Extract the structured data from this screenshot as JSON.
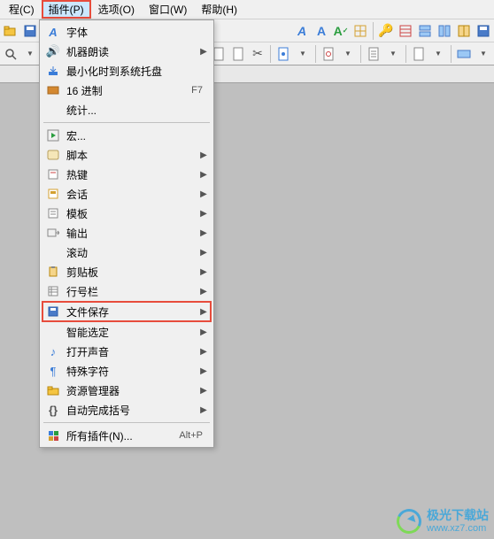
{
  "menubar": {
    "items": [
      {
        "label": "程(C)"
      },
      {
        "label": "插件(P)"
      },
      {
        "label": "选项(O)"
      },
      {
        "label": "窗口(W)"
      },
      {
        "label": "帮助(H)"
      }
    ],
    "highlighted_index": 1
  },
  "toolbar1": {
    "icons": [
      "folder-open",
      "save",
      "save-all",
      "sep",
      "font-a",
      "font-a2",
      "check-a",
      "table",
      "sep",
      "key",
      "table-red",
      "split-h",
      "split-v",
      "layout",
      "save-blue"
    ]
  },
  "toolbar2": {
    "icons": [
      "search",
      "dropdown",
      "sep",
      "page",
      "page",
      "page",
      "cut",
      "sep",
      "doc-left",
      "dropdown",
      "sep",
      "gear",
      "dropdown",
      "sep",
      "list",
      "dropdown",
      "sep",
      "doc",
      "dropdown",
      "sep",
      "filter",
      "dropdown"
    ]
  },
  "dropdown": {
    "highlighted_index": 15,
    "items": [
      {
        "icon": "font",
        "label": "字体",
        "arrow": false
      },
      {
        "icon": "speaker",
        "label": "机器朗读",
        "arrow": true
      },
      {
        "icon": "tray",
        "label": "最小化时到系统托盘",
        "arrow": false
      },
      {
        "icon": "hex",
        "label": "16 进制",
        "shortcut": "F7",
        "arrow": false
      },
      {
        "icon": "",
        "label": "统计...",
        "arrow": false
      },
      {
        "sep": true
      },
      {
        "icon": "play",
        "label": "宏...",
        "arrow": false
      },
      {
        "icon": "script",
        "label": "脚本",
        "arrow": true
      },
      {
        "icon": "hotkey",
        "label": "热键",
        "arrow": true
      },
      {
        "icon": "session",
        "label": "会话",
        "arrow": true
      },
      {
        "icon": "template",
        "label": "模板",
        "arrow": true
      },
      {
        "icon": "output",
        "label": "输出",
        "arrow": true
      },
      {
        "icon": "",
        "label": "滚动",
        "arrow": true
      },
      {
        "icon": "clipboard",
        "label": "剪贴板",
        "arrow": true
      },
      {
        "icon": "linenum",
        "label": "行号栏",
        "arrow": true
      },
      {
        "icon": "save",
        "label": "文件保存",
        "arrow": true
      },
      {
        "icon": "",
        "label": "智能选定",
        "arrow": true
      },
      {
        "icon": "sound",
        "label": "打开声音",
        "arrow": true
      },
      {
        "icon": "pilcrow",
        "label": "特殊字符",
        "arrow": true
      },
      {
        "icon": "folder",
        "label": "资源管理器",
        "arrow": true
      },
      {
        "icon": "bracket",
        "label": "自动完成括号",
        "arrow": true
      },
      {
        "sep": true
      },
      {
        "icon": "plugins",
        "label": "所有插件(N)...",
        "shortcut": "Alt+P",
        "arrow": false
      }
    ]
  },
  "watermark": {
    "title": "极光下载站",
    "url": "www.xz7.com"
  }
}
